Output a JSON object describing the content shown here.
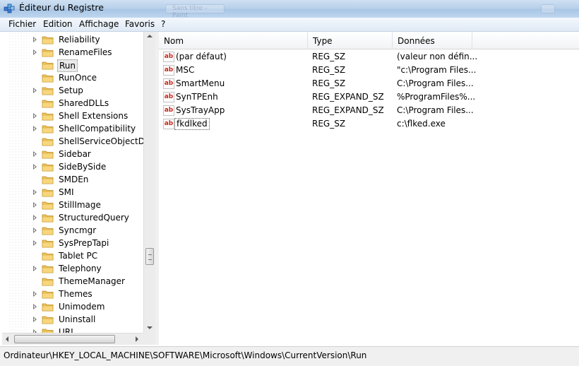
{
  "window": {
    "title": "Éditeur du Registre",
    "ghost_titlebar_text": "Sans titre - Paint"
  },
  "menu": [
    "Fichier",
    "Edition",
    "Affichage",
    "Favoris",
    "?"
  ],
  "tree": {
    "selected": "Run",
    "items": [
      {
        "label": "Reliability",
        "expandable": true
      },
      {
        "label": "RenameFiles",
        "expandable": true
      },
      {
        "label": "Run",
        "expandable": false
      },
      {
        "label": "RunOnce",
        "expandable": false
      },
      {
        "label": "Setup",
        "expandable": true
      },
      {
        "label": "SharedDLLs",
        "expandable": false
      },
      {
        "label": "Shell Extensions",
        "expandable": true
      },
      {
        "label": "ShellCompatibility",
        "expandable": true
      },
      {
        "label": "ShellServiceObjectDelay",
        "expandable": false
      },
      {
        "label": "Sidebar",
        "expandable": true
      },
      {
        "label": "SideBySide",
        "expandable": true
      },
      {
        "label": "SMDEn",
        "expandable": false
      },
      {
        "label": "SMI",
        "expandable": true
      },
      {
        "label": "StillImage",
        "expandable": true
      },
      {
        "label": "StructuredQuery",
        "expandable": true
      },
      {
        "label": "Syncmgr",
        "expandable": true
      },
      {
        "label": "SysPrepTapi",
        "expandable": true
      },
      {
        "label": "Tablet PC",
        "expandable": false
      },
      {
        "label": "Telephony",
        "expandable": true
      },
      {
        "label": "ThemeManager",
        "expandable": false
      },
      {
        "label": "Themes",
        "expandable": true
      },
      {
        "label": "Unimodem",
        "expandable": true
      },
      {
        "label": "Uninstall",
        "expandable": true
      },
      {
        "label": "URL",
        "expandable": true
      }
    ]
  },
  "list": {
    "headers": {
      "name": "Nom",
      "type": "Type",
      "data": "Données"
    },
    "rows": [
      {
        "icon": "ab",
        "name": "(par défaut)",
        "type": "REG_SZ",
        "data": "(valeur non défin..."
      },
      {
        "icon": "ab",
        "name": "MSC",
        "type": "REG_SZ",
        "data": "\"c:\\Program Files..."
      },
      {
        "icon": "ab",
        "name": "SmartMenu",
        "type": "REG_SZ",
        "data": "C:\\Program Files..."
      },
      {
        "icon": "ab",
        "name": "SynTPEnh",
        "type": "REG_EXPAND_SZ",
        "data": "%ProgramFiles%..."
      },
      {
        "icon": "ab",
        "name": "SysTrayApp",
        "type": "REG_EXPAND_SZ",
        "data": "C:\\Program Files..."
      },
      {
        "icon": "ab",
        "name": "fkdlked",
        "type": "REG_SZ",
        "data": "c:\\flked.exe"
      }
    ],
    "focused_row": 5
  },
  "statusbar": {
    "path": "Ordinateur\\HKEY_LOCAL_MACHINE\\SOFTWARE\\Microsoft\\Windows\\CurrentVersion\\Run"
  },
  "icons": {
    "app": "registry-editor-icon",
    "folder": "folder-icon",
    "value": "string-value-icon",
    "expander": "expand-arrow-icon"
  },
  "colors": {
    "titlebar": "#b9d1ea",
    "folder": "#e8b84a",
    "value_icon_text": "#c8261b",
    "selection_bg": "#eaeaea"
  }
}
